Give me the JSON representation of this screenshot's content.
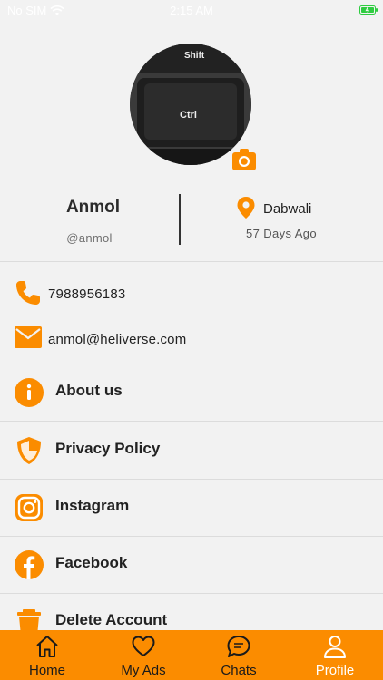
{
  "status_bar": {
    "carrier": "No SIM",
    "time": "2:15 AM"
  },
  "profile": {
    "avatar_text_top": "Shift",
    "avatar_text_mid": "Ctrl",
    "name": "Anmol",
    "username": "@anmol",
    "location": "Dabwali",
    "days_ago": "57 Days Ago"
  },
  "contact": {
    "phone": "7988956183",
    "email": "anmol@heliverse.com"
  },
  "menu": [
    {
      "label": "About us",
      "icon": "info-icon"
    },
    {
      "label": "Privacy Policy",
      "icon": "shield-icon"
    },
    {
      "label": "Instagram",
      "icon": "instagram-icon"
    },
    {
      "label": "Facebook",
      "icon": "facebook-icon"
    },
    {
      "label": "Delete Account",
      "icon": "trash-icon"
    }
  ],
  "tabs": [
    {
      "label": "Home",
      "icon": "home-icon"
    },
    {
      "label": "My Ads",
      "icon": "heart-icon"
    },
    {
      "label": "Chats",
      "icon": "chat-icon"
    },
    {
      "label": "Profile",
      "icon": "person-icon",
      "active": true
    }
  ],
  "colors": {
    "accent": "#fb8c00",
    "background": "#f2f2f2"
  }
}
